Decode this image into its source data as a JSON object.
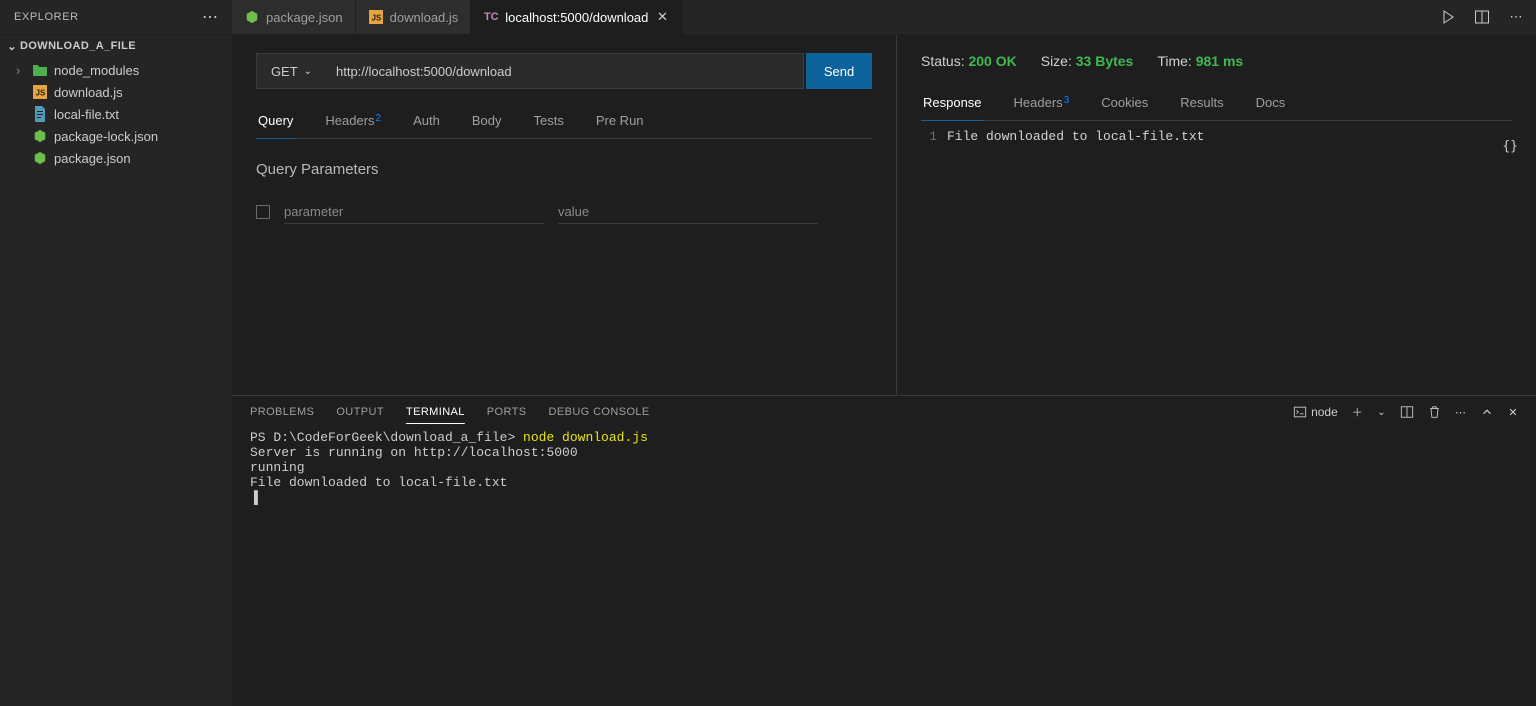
{
  "explorer": {
    "title": "EXPLORER",
    "project": "DOWNLOAD_A_FILE",
    "tree": [
      {
        "label": "node_modules",
        "icon": "folder"
      },
      {
        "label": "download.js",
        "icon": "js"
      },
      {
        "label": "local-file.txt",
        "icon": "txt"
      },
      {
        "label": "package-lock.json",
        "icon": "json"
      },
      {
        "label": "package.json",
        "icon": "json"
      }
    ]
  },
  "tabs": [
    {
      "label": "package.json",
      "icon": "json",
      "active": false
    },
    {
      "label": "download.js",
      "icon": "js",
      "active": false
    },
    {
      "label": "localhost:5000/download",
      "icon": "tc",
      "active": true
    }
  ],
  "request": {
    "method": "GET",
    "url": "http://localhost:5000/download",
    "send_label": "Send",
    "subtabs": [
      "Query",
      "Headers",
      "Auth",
      "Body",
      "Tests",
      "Pre Run"
    ],
    "headers_count": "2",
    "section_title": "Query Parameters",
    "param_placeholder": "parameter",
    "value_placeholder": "value"
  },
  "response": {
    "status_label": "Status:",
    "status_value": "200 OK",
    "size_label": "Size:",
    "size_value": "33 Bytes",
    "time_label": "Time:",
    "time_value": "981 ms",
    "subtabs": [
      "Response",
      "Headers",
      "Cookies",
      "Results",
      "Docs"
    ],
    "headers_count": "3",
    "line_no": "1",
    "body_text": "File downloaded to local-file.txt"
  },
  "panel": {
    "tabs": [
      "PROBLEMS",
      "OUTPUT",
      "TERMINAL",
      "PORTS",
      "DEBUG CONSOLE"
    ],
    "active": "TERMINAL",
    "profile": "node",
    "terminal": {
      "prompt": "PS D:\\CodeForGeek\\download_a_file> ",
      "command": "node download.js",
      "lines": [
        "Server is running on http://localhost:5000",
        "running",
        "File downloaded to local-file.txt",
        "▐"
      ]
    }
  }
}
